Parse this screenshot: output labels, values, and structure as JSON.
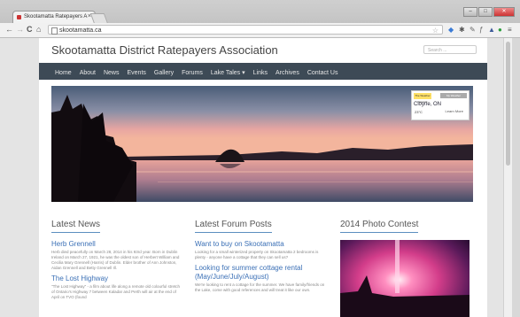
{
  "browser": {
    "tab_title": "Skootamatta Ratepayers A",
    "tab_close": "×",
    "url": "skootamatta.ca",
    "back": "←",
    "forward": "→",
    "reload": "C",
    "home": "⌂"
  },
  "site": {
    "title": "Skootamatta District Ratepayers Association",
    "search_placeholder": "Search ...",
    "nav": [
      "Home",
      "About",
      "News",
      "Events",
      "Gallery",
      "Forums",
      "Lake Tales ▾",
      "Links",
      "Archives",
      "Contact Us"
    ]
  },
  "weather": {
    "logo": "The Weather Network",
    "button": "My Weather",
    "city": "Cloyne, ON",
    "temp": "23°C",
    "more": "Learn More"
  },
  "latest_news": {
    "heading": "Latest News",
    "posts": [
      {
        "title": "Herb Grennell",
        "body": "Herb died peacefully on March 28, 2014 in his 93rd year. Born in Dublin Ireland on March 27, 1921, he was the oldest son of Herbert William and Cecilia Mary Grennell (Harris) of Dublin. Elder brother of Ann Johnston, Aidan Grennell and Betty Grennell Ill."
      },
      {
        "title": "The Lost Highway",
        "body": "\"The Lost Highway\" - a film about life along a remote old colourful stretch of Ontario's Highway 7 between Kaladar and Perth will air at the end of April on TVO (found"
      }
    ]
  },
  "forum": {
    "heading": "Latest Forum Posts",
    "posts": [
      {
        "title": "Want to buy on Skootamatta",
        "body": "Looking for a small winterized property on Skootamatta 2 bedrooms is plenty - anyone have a cottage that they can sell us?"
      },
      {
        "title": "Looking for summer cottage rental (May/June/July/August)",
        "body": "We're looking to rent a cottage for the summer. We have family/friends on the Lake, come with good references and will treat it like our own."
      }
    ]
  },
  "photo_contest": {
    "heading": "2014 Photo Contest"
  }
}
